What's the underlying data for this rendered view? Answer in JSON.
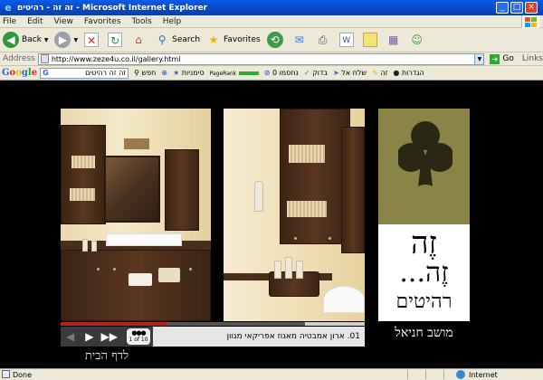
{
  "window": {
    "title": "זה זה - רהיטים - Microsoft Internet Explorer",
    "controls": {
      "minimize": "_",
      "maximize": "□",
      "close": "×"
    }
  },
  "menu": {
    "items": [
      "File",
      "Edit",
      "View",
      "Favorites",
      "Tools",
      "Help"
    ]
  },
  "toolbar": {
    "back": "Back",
    "search": "Search",
    "favorites": "Favorites"
  },
  "address": {
    "label": "Address",
    "url": "http://www.zeze4u.co.il/gallery.html",
    "go": "Go",
    "links": "Links"
  },
  "google": {
    "logo": "Google",
    "query": "זה זה רהיטים",
    "search_btn": "חפש",
    "bookmarks": "סימניות",
    "pagerank": "PageRank",
    "blocked": "נחסמו 0",
    "spellcheck": "בדוק",
    "send": "שלח אל",
    "lang": "זה",
    "settings": "הגדרות"
  },
  "gallery": {
    "caption": "01. ארון אמבטיה מאגוז אפריקאי מגוון",
    "counter": "1 of 10",
    "home_link": "לדף הבית",
    "progress": 0.35
  },
  "logo": {
    "line1": "זֶה",
    "line2": "זֶה...",
    "subtitle": "רהיטים",
    "tagline": "מושב חניאל",
    "colors": {
      "panel": "#8a8446",
      "club": "#2a2814"
    }
  },
  "status": {
    "left": "Done",
    "zone": "Internet"
  }
}
